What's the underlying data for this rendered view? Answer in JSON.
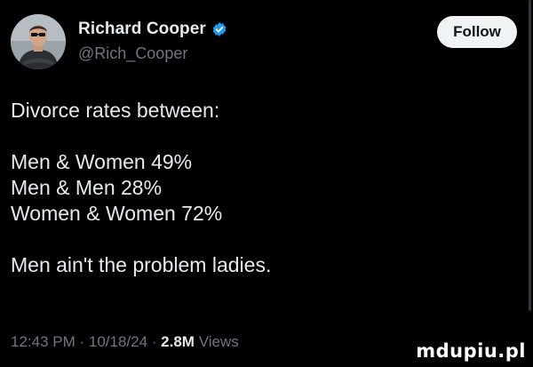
{
  "author": {
    "display_name": "Richard Cooper",
    "handle": "@Rich_Cooper",
    "verified_icon": "verified-badge-icon",
    "avatar": "profile-photo"
  },
  "follow_label": "Follow",
  "tweet": {
    "lines": [
      "Divorce rates between:",
      "",
      "Men & Women 49%",
      "Men & Men 28%",
      "Women & Women 72%",
      "",
      "Men ain't the problem ladies."
    ]
  },
  "meta": {
    "time": "12:43 PM",
    "separator1": " · ",
    "date": "10/18/24",
    "separator2": " · ",
    "views_count": "2.8M",
    "views_label": " Views"
  },
  "watermark": "mdupiu.pl",
  "colors": {
    "background": "#000000",
    "text_primary": "#e7e9ea",
    "text_secondary": "#71767b",
    "verified_blue": "#1d9bf0",
    "follow_bg": "#eff3f4"
  }
}
